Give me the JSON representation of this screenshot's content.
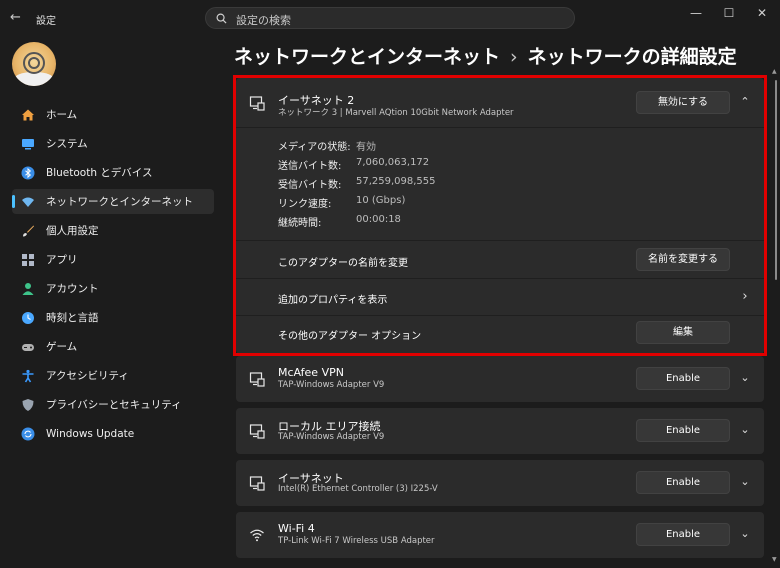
{
  "window": {
    "app_title": "設定",
    "search_placeholder": "設定の検索",
    "controls": {
      "minimize": "—",
      "maximize": "☐",
      "close": "✕"
    }
  },
  "sidebar": {
    "items": [
      {
        "label": "ホーム",
        "icon": "home-icon",
        "color": "#f0a040"
      },
      {
        "label": "システム",
        "icon": "display-icon",
        "color": "#4aa8ff"
      },
      {
        "label": "Bluetooth とデバイス",
        "icon": "bluetooth-icon",
        "color": "#3a8ee8"
      },
      {
        "label": "ネットワークとインターネット",
        "icon": "wifi-icon",
        "color": "#6fb7f0",
        "active": true
      },
      {
        "label": "個人用設定",
        "icon": "brush-icon",
        "color": "#f0b060"
      },
      {
        "label": "アプリ",
        "icon": "apps-icon",
        "color": "#b0b8c8"
      },
      {
        "label": "アカウント",
        "icon": "person-icon",
        "color": "#3ec48a"
      },
      {
        "label": "時刻と言語",
        "icon": "globe-clock-icon",
        "color": "#4aa8ff"
      },
      {
        "label": "ゲーム",
        "icon": "gamepad-icon",
        "color": "#b0b0b0"
      },
      {
        "label": "アクセシビリティ",
        "icon": "accessibility-icon",
        "color": "#3a9aff"
      },
      {
        "label": "プライバシーとセキュリティ",
        "icon": "shield-icon",
        "color": "#9aa4b0"
      },
      {
        "label": "Windows Update",
        "icon": "update-icon",
        "color": "#3a8ee8"
      }
    ]
  },
  "header": {
    "parent": "ネットワークとインターネット",
    "separator": "›",
    "current": "ネットワークの詳細設定"
  },
  "expanded_adapter": {
    "name": "イーサネット 2",
    "description": "ネットワーク 3 | Marvell AQtion 10Gbit Network Adapter",
    "toggle_button": "無効にする",
    "properties": [
      {
        "key": "メディアの状態:",
        "value": "有効"
      },
      {
        "key": "送信バイト数:",
        "value": "7,060,063,172"
      },
      {
        "key": "受信バイト数:",
        "value": "57,259,098,555"
      },
      {
        "key": "リンク速度:",
        "value": "10 (Gbps)"
      },
      {
        "key": "継続時間:",
        "value": "00:00:18"
      }
    ],
    "rename_label": "このアダプターの名前を変更",
    "rename_button": "名前を変更する",
    "more_props_label": "追加のプロパティを表示",
    "other_options_label": "その他のアダプター オプション",
    "edit_button": "編集"
  },
  "adapters": [
    {
      "name": "McAfee VPN",
      "description": "TAP-Windows Adapter V9",
      "button": "Enable",
      "icon": "ethernet-icon"
    },
    {
      "name": "ローカル エリア接続",
      "description": "TAP-Windows Adapter V9",
      "button": "Enable",
      "icon": "ethernet-icon"
    },
    {
      "name": "イーサネット",
      "description": "Intel(R) Ethernet Controller (3) I225-V",
      "button": "Enable",
      "icon": "ethernet-icon"
    },
    {
      "name": "Wi-Fi 4",
      "description": "TP-Link Wi-Fi 7 Wireless USB Adapter",
      "button": "Enable",
      "icon": "wifi-icon"
    }
  ],
  "colors": {
    "accent": "#4cc2ff",
    "highlight_border": "#e10000",
    "card": "#2b2b2b",
    "background": "#1c1c1c"
  }
}
